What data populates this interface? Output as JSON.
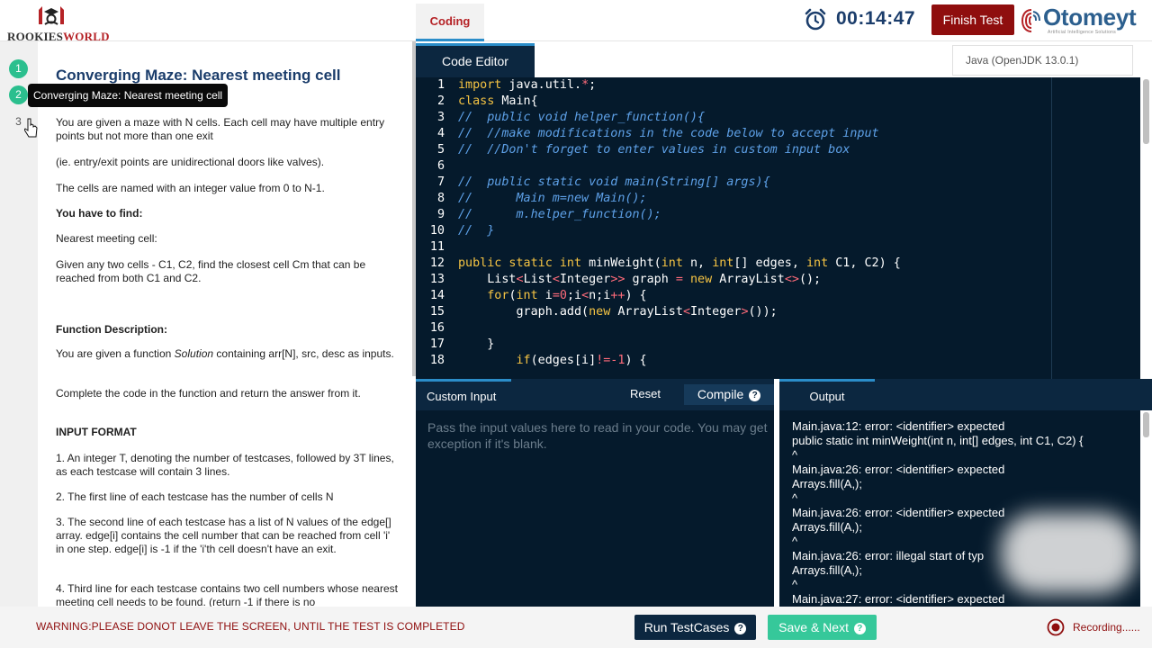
{
  "header": {
    "logo_text_a": "ROOKIES",
    "logo_text_b": "WORLD",
    "section_tab": "Coding",
    "timer": "00:14:47",
    "finish_button": "Finish Test",
    "brand_name": "Otomeyt",
    "brand_tagline": "Artificial Intelligence Solutions"
  },
  "question_nav": {
    "items": [
      "1",
      "2",
      "3"
    ],
    "tooltip": "Converging Maze: Nearest meeting cell"
  },
  "problem": {
    "title": "Converging Maze: Nearest meeting cell",
    "lines": [
      "You are given a maze with N cells. Each cell may have multiple entry points but not more than one exit",
      "(ie. entry/exit points are unidirectional doors like valves).",
      "The cells are named with an integer value from 0 to N-1.",
      "You have to find:",
      "Nearest meeting cell:",
      "Given any two cells - C1, C2, find the closest cell Cm that can be reached from both C1 and C2.",
      "Function Description:",
      "You are given a function",
      "Solution",
      "containing arr[N], src, desc as inputs.",
      "Complete the code in the function and return the answer from it.",
      "INPUT FORMAT",
      "1. An integer T, denoting the number of testcases, followed by 3T lines, as each testcase will contain 3 lines.",
      "2. The first line of each testcase has the number of cells N",
      "3. The second line of each testcase has a list of N values of the edge[] array. edge[i] contains the cell number that can be reached from cell 'i' in one step. edge[i] is -1 if the 'i'th cell doesn't have an exit.",
      "4. Third line for each testcase contains two cell numbers whose nearest meeting cell needs to be found. (return -1 if there is no"
    ]
  },
  "editor": {
    "tab": "Code Editor",
    "language": "Java (OpenJDK 13.0.1)",
    "line_numbers": [
      "1",
      "2",
      "3",
      "4",
      "5",
      "6",
      "7",
      "8",
      "9",
      "10",
      "11",
      "12",
      "13",
      "14",
      "15",
      "16",
      "17",
      "18"
    ],
    "code": [
      "import java.util.*;",
      "class Main{",
      "//  public void helper_function(){",
      "//  //make modifications in the code below to accept input",
      "//  //Don't forget to enter values in custom input box",
      "",
      "//  public static void main(String[] args){",
      "//      Main m=new Main();",
      "//      m.helper_function();",
      "//  }",
      "",
      "public static int minWeight(int n, int[] edges, int C1, C2) {",
      "    List<List<Integer>> graph = new ArrayList<>();",
      "    for(int i=0;i<n;i++) {",
      "        graph.add(new ArrayList<Integer>());",
      "",
      "    }",
      "        if(edges[i]!=-1) {"
    ]
  },
  "custom_input": {
    "tab": "Custom Input",
    "reset": "Reset",
    "compile": "Compile",
    "placeholder": "Pass the input values here to read in your code. You may get exception if it's blank."
  },
  "output": {
    "tab": "Output",
    "lines": [
      "Main.java:12: error: <identifier> expected",
      "public static int minWeight(int n, int[] edges, int C1, C2) {",
      "^",
      "Main.java:26: error: <identifier> expected",
      "Arrays.fill(A,);",
      "^",
      "Main.java:26: error: <identifier> expected",
      "Arrays.fill(A,);",
      "^",
      "Main.java:26: error: illegal start of typ",
      "Arrays.fill(A,);",
      "^",
      "Main.java:27: error: <identifier> expected"
    ]
  },
  "footer": {
    "warning": "WARNING:PLEASE DONOT LEAVE THE SCREEN, UNTIL THE TEST IS COMPLETED",
    "run_button": "Run TestCases",
    "save_button": "Save & Next",
    "recording": "Recording......"
  },
  "colors": {
    "editor_bg": "#051a2c",
    "panel_bar": "#0c2740",
    "accent_blue": "#2b8dc9",
    "danger": "#8f0e0e",
    "success": "#36c89a",
    "heading": "#1b3d6b"
  }
}
